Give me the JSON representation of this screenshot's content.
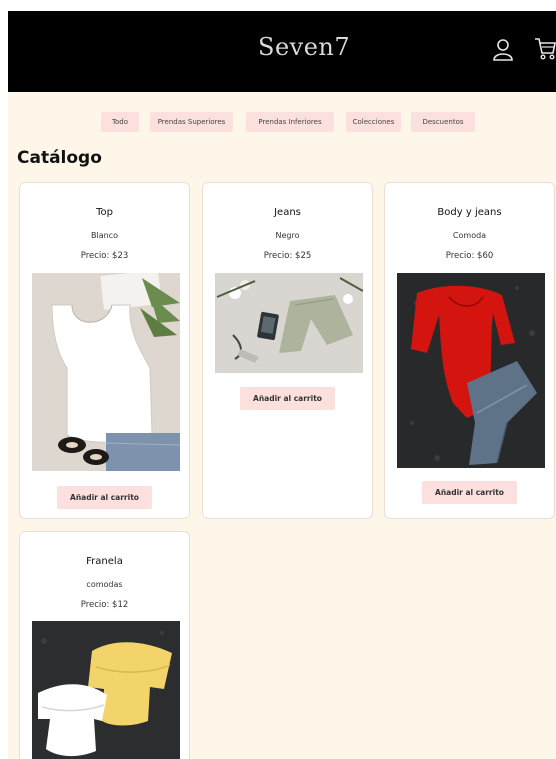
{
  "header": {
    "logo": "Seven7",
    "user_icon": "user-icon",
    "cart_icon": "cart-icon"
  },
  "filters": [
    "Todo",
    "Prendas Superiores",
    "Prendas Inferiores",
    "Colecciones",
    "Descuentos"
  ],
  "catalog": {
    "title": "Catálogo",
    "products": [
      {
        "name": "Top",
        "color": "Blanco",
        "price": "Precio: $23",
        "button": "Añadir al carrito"
      },
      {
        "name": "Jeans",
        "color": "Negro",
        "price": "Precio: $25",
        "button": "Añadir al carrito"
      },
      {
        "name": "Body y jeans",
        "color": "Comoda",
        "price": "Precio: $60",
        "button": "Añadir al carrito"
      },
      {
        "name": "Franela",
        "color": "comodas",
        "price": "Precio: $12"
      }
    ]
  },
  "colors": {
    "header_bg": "#000000",
    "page_bg": "#fff6ea",
    "button_bg": "#fbe0dd"
  }
}
